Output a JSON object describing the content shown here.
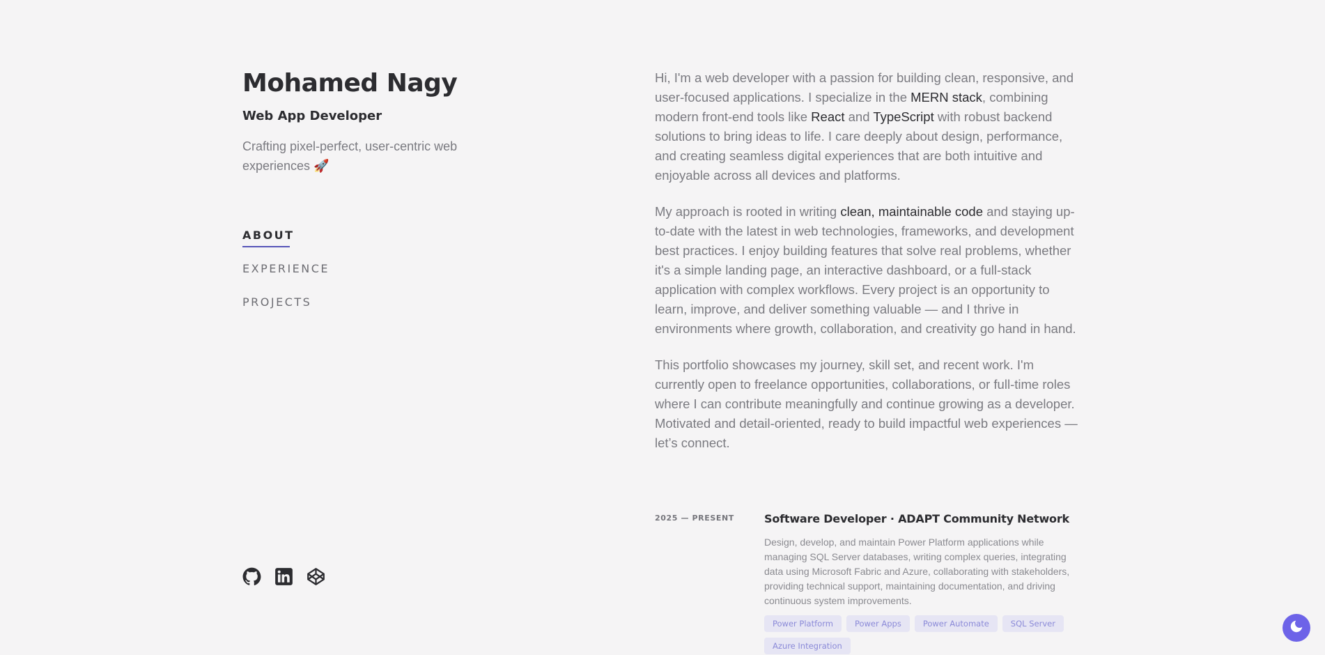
{
  "header": {
    "name": "Mohamed Nagy",
    "role": "Web App Developer",
    "tagline": "Crafting pixel-perfect, user-centric web experiences 🚀"
  },
  "nav": {
    "items": [
      {
        "label": "ABOUT",
        "active": true
      },
      {
        "label": "EXPERIENCE",
        "active": false
      },
      {
        "label": "PROJECTS",
        "active": false
      }
    ]
  },
  "socials": [
    "github-icon",
    "linkedin-icon",
    "codepen-icon"
  ],
  "about": {
    "p1": {
      "t1": "Hi, I'm a web developer with a passion for building clean, responsive, and user-focused applications. I specialize in the ",
      "h1": "MERN stack",
      "t2": ", combining modern front-end tools like ",
      "h2": "React",
      "t3": " and ",
      "h3": "TypeScript",
      "t4": " with robust backend solutions to bring ideas to life. I care deeply about design, performance, and creating seamless digital experiences that are both intuitive and enjoyable across all devices and platforms."
    },
    "p2": {
      "t1": "My approach is rooted in writing ",
      "h1": "clean, maintainable code",
      "t2": " and staying up-to-date with the latest in web technologies, frameworks, and development best practices. I enjoy building features that solve real problems, whether it's a simple landing page, an interactive dashboard, or a full-stack application with complex workflows. Every project is an opportunity to learn, improve, and deliver something valuable — and I thrive in environments where growth, collaboration, and creativity go hand in hand."
    },
    "p3": "This portfolio showcases my journey, skill set, and recent work. I'm currently open to freelance opportunities, collaborations, or full-time roles where I can contribute meaningfully and continue growing as a developer. Motivated and detail-oriented, ready to build impactful web experiences — let’s connect."
  },
  "experience": {
    "date": "2025 — PRESENT",
    "title": "Software Developer · ADAPT Community Network",
    "description": "Design, develop, and maintain Power Platform applications while managing SQL Server databases, writing complex queries, integrating data using Microsoft Fabric and Azure, collaborating with stakeholders, providing technical support, maintaining documentation, and driving continuous system improvements.",
    "tags": [
      "Power Platform",
      "Power Apps",
      "Power Automate",
      "SQL Server",
      "Azure Integration"
    ]
  },
  "theme_toggle": {
    "icon": "moon-icon",
    "color": "#6d63e8"
  },
  "colors": {
    "background": "#f5f4f5",
    "heading": "#2c2c30",
    "body_text": "#7a7a80",
    "accent": "#5553b8",
    "tag_bg": "#e6e5f4",
    "tag_text": "#8b8ad8"
  }
}
